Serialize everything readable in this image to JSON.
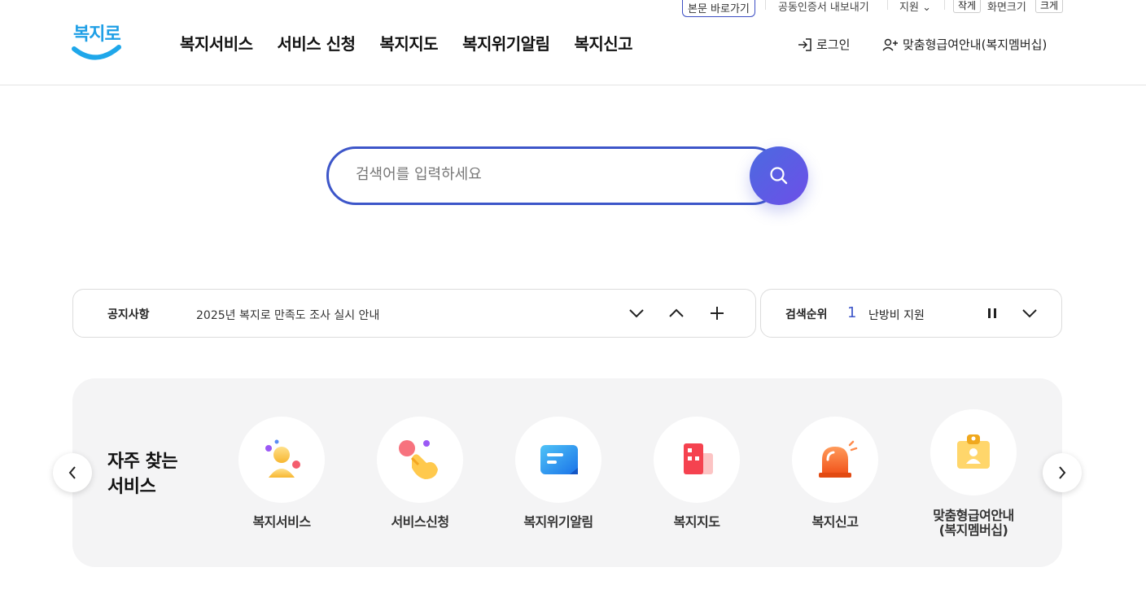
{
  "utility": {
    "skip_label": "본문 바로가기",
    "cert_label": "공동인증서 내보내기",
    "support_label": "지원",
    "font_small": "작게",
    "font_size_label": "화면크기",
    "font_large": "크게"
  },
  "logo": {
    "text": "복지로"
  },
  "gnb": [
    "복지서비스",
    "서비스 신청",
    "복지지도",
    "복지위기알림",
    "복지신고"
  ],
  "header_right": {
    "login": "로그인",
    "membership": "맞춤형급여안내(복지멤버십)"
  },
  "search": {
    "placeholder": "검색어를 입력하세요"
  },
  "notice": {
    "label": "공지사항",
    "message": "2025년 복지로 만족도 조사 실시 안내"
  },
  "ranking": {
    "label": "검색순위",
    "rank": "1",
    "term": "난방비 지원"
  },
  "quick": {
    "title_line1": "자주 찾는",
    "title_line2": "서비스",
    "items": [
      {
        "label": "복지서비스",
        "icon": "person-icon"
      },
      {
        "label": "서비스신청",
        "icon": "hand-tap-icon"
      },
      {
        "label": "복지위기알림",
        "icon": "message-icon"
      },
      {
        "label": "복지지도",
        "icon": "building-icon"
      },
      {
        "label": "복지신고",
        "icon": "siren-icon"
      },
      {
        "label": "맞춤형급여안내\n(복지멤버십)",
        "icon": "id-badge-icon"
      }
    ]
  },
  "colors": {
    "brand": "#1f9fe6",
    "accent": "#3d56c9",
    "search_btn": "#5a5ee4"
  }
}
